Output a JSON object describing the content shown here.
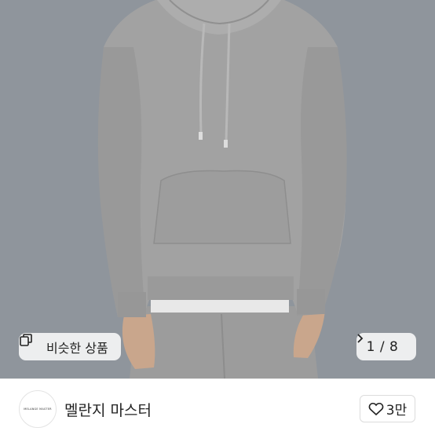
{
  "product": {
    "image_alt": "gray hoodie",
    "similar_label": "비슷한 상품",
    "counter": "1 / 8"
  },
  "shop": {
    "logo_text": "MELANGE MASTER",
    "name": "멜란지 마스터",
    "likes": "3만"
  },
  "icons": {
    "similar": "similar-items-icon",
    "next": "chevron-right-icon",
    "like": "heart-icon"
  }
}
